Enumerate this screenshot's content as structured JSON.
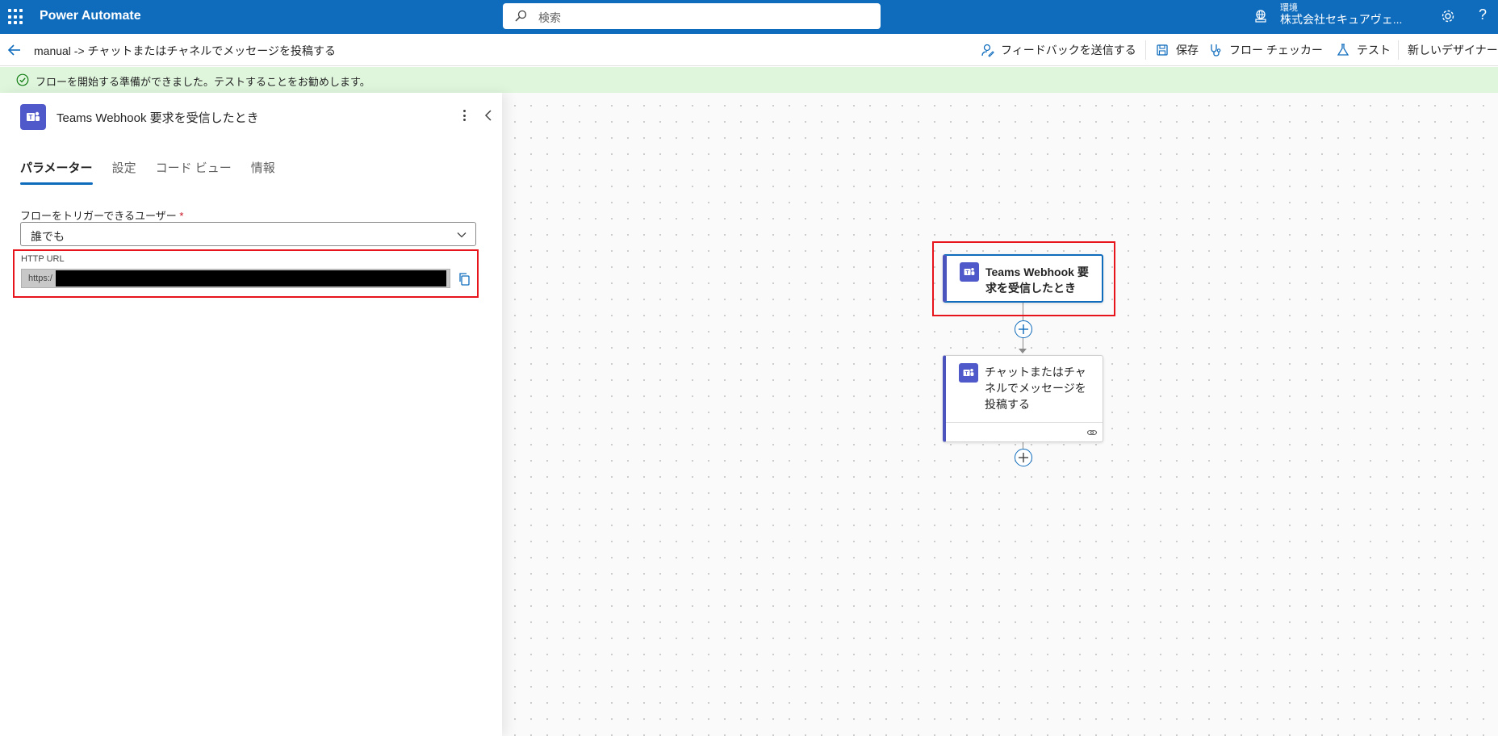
{
  "app": {
    "title": "Power Automate"
  },
  "search": {
    "placeholder": "検索"
  },
  "environment": {
    "label": "環境",
    "name": "株式会社セキュアヴェ..."
  },
  "command_bar": {
    "breadcrumb": "manual -> チャットまたはチャネルでメッセージを投稿する",
    "feedback": "フィードバックを送信する",
    "save": "保存",
    "flow_checker": "フロー チェッカー",
    "test": "テスト",
    "new_designer": "新しいデザイナー"
  },
  "banner": {
    "text": "フローを開始する準備ができました。テストすることをお勧めします。"
  },
  "panel": {
    "title": "Teams Webhook 要求を受信したとき",
    "tabs": [
      "パラメーター",
      "設定",
      "コード ビュー",
      "情報"
    ],
    "active_tab": "パラメーター",
    "trigger_users": {
      "label": "フローをトリガーできるユーザー",
      "required_mark": "*",
      "value": "誰でも"
    },
    "http_url": {
      "label": "HTTP URL",
      "value": "https:/"
    }
  },
  "canvas": {
    "nodes": [
      {
        "title": "Teams Webhook 要求を受信したとき",
        "selected": true
      },
      {
        "title": "チャットまたはチャネルでメッセージを投稿する",
        "selected": false
      }
    ]
  },
  "colors": {
    "brand": "#0f6cbd",
    "teams": "#5059c9",
    "highlight": "#e8141c",
    "banner": "#dff6dd"
  }
}
